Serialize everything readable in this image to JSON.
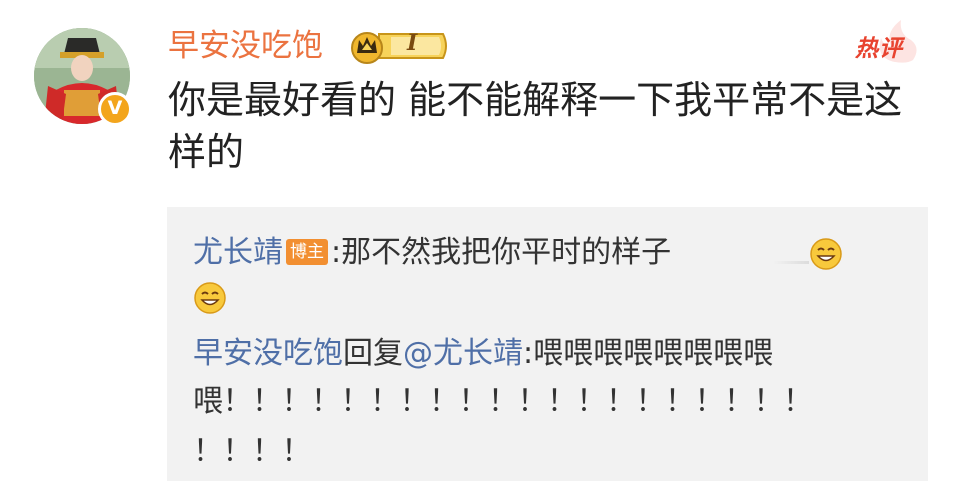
{
  "comment": {
    "username": "早安没吃饱",
    "verified_badge": "V",
    "level_badge": {
      "icon": "crown-icon",
      "level": "I"
    },
    "hot_label": "热评",
    "text": "你是最好看的 能不能解释一下我平常不是这样的"
  },
  "replies": [
    {
      "author": "尤长靖",
      "author_tag": "博主",
      "separator": ":",
      "text": "那不然我把你平时的样子",
      "emoji": [
        "grin-face-icon",
        "grin-face-icon"
      ]
    },
    {
      "author": "早安没吃饱",
      "action": "回复",
      "mention": "@尤长靖",
      "separator": ":",
      "text_line1": "喂喂喂喂喂喂喂喂",
      "text_line2": "喂！！！！！！！！！！！！！！！！！！！！",
      "text_line3": "！！！！"
    }
  ],
  "colors": {
    "username": "#eb7340",
    "link": "#4f6fa7",
    "hot": "#e8432f",
    "reply_bg": "#f2f2f2",
    "host_tag": "#f28f31",
    "verified": "#f3a51c"
  }
}
